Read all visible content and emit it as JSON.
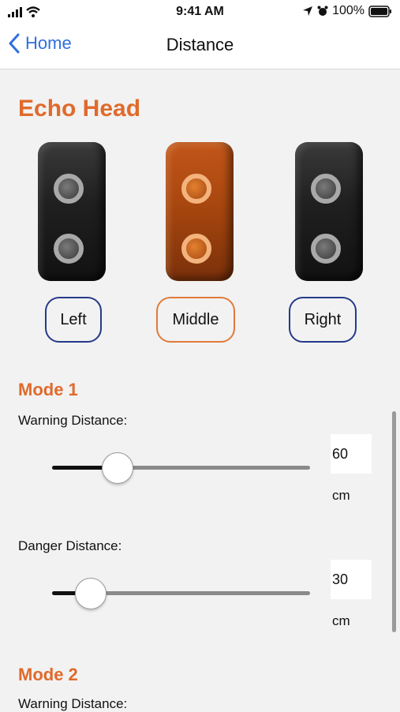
{
  "status_bar": {
    "time": "9:41 AM",
    "battery": "100%"
  },
  "nav": {
    "back_label": "Home",
    "title": "Distance"
  },
  "echo_head": {
    "title": "Echo Head",
    "buttons": {
      "left": "Left",
      "middle": "Middle",
      "right": "Right"
    },
    "selected": "Middle"
  },
  "mode1": {
    "title": "Mode 1",
    "warning": {
      "label": "Warning Distance:",
      "value": "60",
      "unit": "cm",
      "slider_fraction": 0.255
    },
    "danger": {
      "label": "Danger Distance:",
      "value": "30",
      "unit": "cm",
      "slider_fraction": 0.15
    }
  },
  "mode2": {
    "title": "Mode 2",
    "warning": {
      "label": "Warning Distance:"
    }
  },
  "colors": {
    "accent": "#e06a2c",
    "link": "#2f6fe0",
    "button_border": "#253a8a"
  }
}
